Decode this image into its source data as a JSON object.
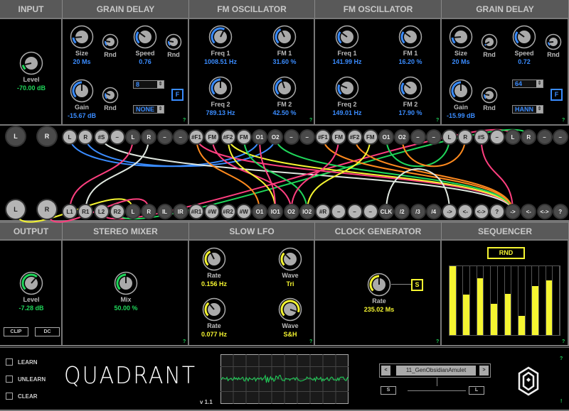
{
  "colors": {
    "blue": "#3a8cff",
    "green": "#1fd65a",
    "yellow": "#f5f531",
    "pink": "#ff3f7f",
    "orange": "#ff8a1e",
    "white": "#e0e8e0"
  },
  "top_modules": [
    {
      "title": "INPUT",
      "knobs": [
        {
          "label": "Level",
          "value": "-70.00 dB",
          "pos": 0.12,
          "color": "green"
        }
      ]
    },
    {
      "title": "GRAIN DELAY",
      "knobs": [
        {
          "label": "Size",
          "value": "20 Ms",
          "pos": 0.15,
          "color": "blue"
        },
        {
          "label": "Rnd",
          "value": "",
          "pos": 0.2,
          "color": "blue"
        },
        {
          "label": "Speed",
          "value": "0.76",
          "pos": 0.3,
          "color": "blue"
        },
        {
          "label": "Rnd",
          "value": "",
          "pos": 0.2,
          "color": "blue"
        },
        {
          "label": "Gain",
          "value": "-15.67 dB",
          "pos": 0.5,
          "color": "blue"
        },
        {
          "label": "Rnd",
          "value": "",
          "pos": 0.25,
          "color": "blue"
        }
      ],
      "grains": "8",
      "window": "NONE",
      "freeze": "F",
      "help": "?"
    },
    {
      "title": "FM OSCILLATOR",
      "knobs": [
        {
          "label": "Freq 1",
          "value": "1008.51 Hz",
          "pos": 0.6,
          "color": "blue"
        },
        {
          "label": "FM 1",
          "value": "31.60 %",
          "pos": 0.4,
          "color": "blue"
        },
        {
          "label": "Freq 2",
          "value": "789.13 Hz",
          "pos": 0.5,
          "color": "blue"
        },
        {
          "label": "FM 2",
          "value": "42.50 %",
          "pos": 0.43,
          "color": "blue"
        }
      ],
      "help": "?"
    },
    {
      "title": "FM OSCILLATOR",
      "knobs": [
        {
          "label": "Freq 1",
          "value": "141.99 Hz",
          "pos": 0.3,
          "color": "blue"
        },
        {
          "label": "FM 1",
          "value": "16.20 %",
          "pos": 0.3,
          "color": "blue"
        },
        {
          "label": "Freq 2",
          "value": "149.01 Hz",
          "pos": 0.25,
          "color": "blue"
        },
        {
          "label": "FM 2",
          "value": "17.90 %",
          "pos": 0.3,
          "color": "blue"
        }
      ],
      "help": "?"
    },
    {
      "title": "GRAIN DELAY",
      "knobs": [
        {
          "label": "Size",
          "value": "20 Ms",
          "pos": 0.15,
          "color": "blue"
        },
        {
          "label": "Rnd",
          "value": "",
          "pos": 0.06,
          "color": "blue"
        },
        {
          "label": "Speed",
          "value": "0.72",
          "pos": 0.3,
          "color": "blue"
        },
        {
          "label": "Rnd",
          "value": "",
          "pos": 0.15,
          "color": "blue"
        },
        {
          "label": "Gain",
          "value": "-15.99 dB",
          "pos": 0.5,
          "color": "blue"
        },
        {
          "label": "Rnd",
          "value": "",
          "pos": 0.2,
          "color": "blue"
        }
      ],
      "grains": "64",
      "window": "HANN",
      "freeze": "F",
      "help": "?"
    }
  ],
  "patchbay": {
    "top_main": [
      "L",
      "R"
    ],
    "bottom_main": [
      "L",
      "R"
    ],
    "top_jacks": [
      "L",
      "R",
      "#S",
      "–",
      "L",
      "R",
      "–",
      "–",
      "#F1",
      "FM",
      "#F2",
      "FM",
      "O1",
      "O2",
      "–",
      "–",
      "#F1",
      "FM",
      "#F2",
      "FM",
      "O1",
      "O2",
      "–",
      "–",
      "L",
      "R",
      "#S",
      "–",
      "L",
      "R",
      "–",
      "–"
    ],
    "bottom_jacks": [
      "L1",
      "R1",
      "L2",
      "R2",
      "L",
      "R",
      "IL",
      "IR",
      "#R1",
      "#W",
      "#R2",
      "#W",
      "O1",
      "IO1",
      "O2",
      "IO2",
      "#R",
      "–",
      "–",
      "–",
      "CLK",
      "/2",
      "/3",
      "/4",
      "->",
      "<-",
      "<->",
      "?",
      "->",
      "<-",
      "<->",
      "?"
    ],
    "cables": [
      {
        "from": "t0",
        "to": "t12",
        "color": "blue"
      },
      {
        "from": "t1",
        "to": "t13",
        "color": "blue"
      },
      {
        "from": "t2",
        "to": "b28",
        "color": "white"
      },
      {
        "from": "t4",
        "to": "b0",
        "color": "pink"
      },
      {
        "from": "t5",
        "to": "b1",
        "color": "white"
      },
      {
        "from": "B0",
        "to": "b4",
        "color": "yellow"
      },
      {
        "from": "B1",
        "to": "b5",
        "color": "pink"
      },
      {
        "from": "b2",
        "to": "t28",
        "color": "pink"
      },
      {
        "from": "b3",
        "to": "t29",
        "color": "green"
      },
      {
        "from": "t8",
        "to": "b12",
        "color": "orange"
      },
      {
        "from": "t8",
        "to": "b28",
        "color": "pink"
      },
      {
        "from": "t9",
        "to": "b14",
        "color": "pink"
      },
      {
        "from": "t10",
        "to": "b13",
        "color": "yellow"
      },
      {
        "from": "t10",
        "to": "b28",
        "color": "yellow"
      },
      {
        "from": "t11",
        "to": "b15",
        "color": "green"
      },
      {
        "from": "t12",
        "to": "b13",
        "color": "pink"
      },
      {
        "from": "t13",
        "to": "b28",
        "color": "green"
      },
      {
        "from": "t16",
        "to": "b28",
        "color": "orange"
      },
      {
        "from": "t17",
        "to": "b14",
        "color": "pink"
      },
      {
        "from": "t18",
        "to": "b28",
        "color": "orange"
      },
      {
        "from": "t19",
        "to": "b15",
        "color": "yellow"
      },
      {
        "from": "t20",
        "to": "t24",
        "color": "green"
      },
      {
        "from": "t21",
        "to": "t25",
        "color": "orange"
      },
      {
        "from": "t26",
        "to": "b28",
        "color": "pink"
      },
      {
        "from": "b20",
        "to": "b24",
        "color": "white"
      }
    ]
  },
  "bottom_modules": [
    {
      "title": "OUTPUT",
      "knobs": [
        {
          "label": "Level",
          "value": "-7.28 dB",
          "pos": 0.65,
          "color": "green"
        }
      ],
      "clip": "CLIP",
      "dc": "DC"
    },
    {
      "title": "STEREO MIXER",
      "knobs": [
        {
          "label": "Mix",
          "value": "50.00 %",
          "pos": 0.5,
          "color": "green"
        }
      ],
      "help": "?"
    },
    {
      "title": "SLOW LFO",
      "knobs": [
        {
          "label": "Rate",
          "value": "0.156 Hz",
          "pos": 0.4,
          "color": "yellow"
        },
        {
          "label": "Wave",
          "value": "Tri",
          "pos": 0.33,
          "color": "yellow"
        },
        {
          "label": "Rate",
          "value": "0.077 Hz",
          "pos": 0.35,
          "color": "yellow"
        },
        {
          "label": "Wave",
          "value": "S&H",
          "pos": 0.9,
          "color": "yellow"
        }
      ],
      "help": "?"
    },
    {
      "title": "CLOCK GENERATOR",
      "knobs": [
        {
          "label": "Rate",
          "value": "235.02 Ms",
          "pos": 0.5,
          "color": "yellow"
        }
      ],
      "sync": "S",
      "help": "?"
    },
    {
      "title": "SEQUENCER",
      "rnd": "RND",
      "steps": [
        1.0,
        0.59,
        0.83,
        0.45,
        0.6,
        0.28,
        0.71,
        0.79
      ],
      "help": "?"
    }
  ],
  "footer": {
    "learn": "LEARN",
    "unlearn": "UNLEARN",
    "clear": "CLEAR",
    "logo": "QUADRANT",
    "version": "v 1.1",
    "preset_prev": "<",
    "preset_name": "11_GenObsidianAmulet",
    "preset_next": ">",
    "save": "S",
    "load": "L",
    "help": "?",
    "alert": "!"
  }
}
